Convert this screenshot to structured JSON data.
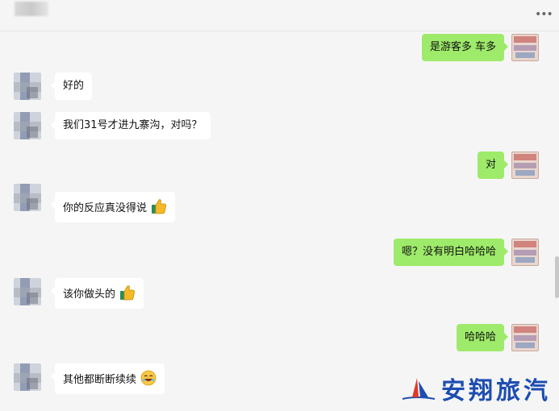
{
  "header": {
    "more_icon": "more-horizontal-icon"
  },
  "messages": [
    {
      "side": "self",
      "text": "是游客多  车多",
      "emoji": null
    },
    {
      "side": "other",
      "text": "好的",
      "emoji": null
    },
    {
      "side": "other",
      "text": "我们31号才进九寨沟，对吗？",
      "emoji": null
    },
    {
      "side": "self",
      "text": "对",
      "emoji": null
    },
    {
      "side": "other",
      "text": "你的反应真没得说",
      "emoji": "thumbs-up-icon"
    },
    {
      "side": "self",
      "text": "嗯？没有明白哈哈哈",
      "emoji": null
    },
    {
      "side": "other",
      "text": "该你做头的",
      "emoji": "thumbs-up-icon"
    },
    {
      "side": "self",
      "text": "哈哈哈",
      "emoji": null
    },
    {
      "side": "other",
      "text": "其他都断断续续",
      "emoji": "laughing-face-icon"
    }
  ],
  "watermark": {
    "text": "安翔旅汽"
  },
  "colors": {
    "self_bubble": "#9eea6a",
    "other_bubble": "#ffffff",
    "background": "#f5f5f5",
    "watermark": "#1d4db1"
  }
}
